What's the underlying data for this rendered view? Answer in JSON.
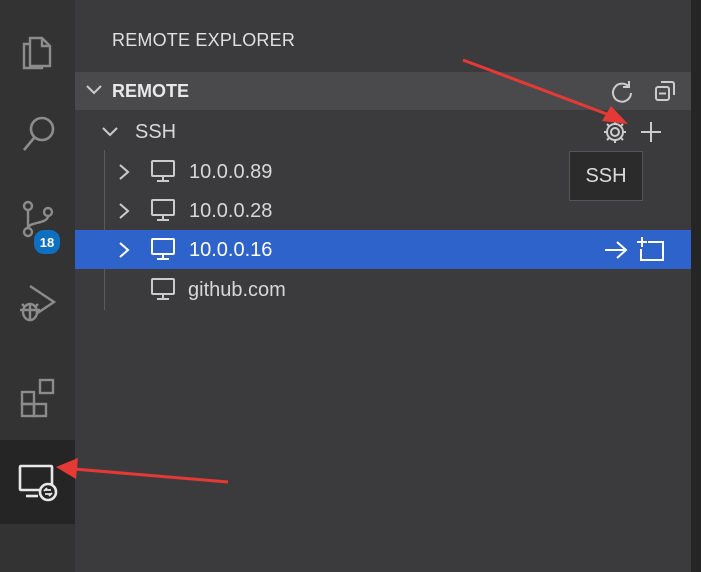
{
  "activity_bar": {
    "items": [
      {
        "icon": "files-icon"
      },
      {
        "icon": "search-icon"
      },
      {
        "icon": "source-control-icon",
        "badge": "18"
      },
      {
        "icon": "run-debug-icon"
      },
      {
        "icon": "extensions-icon"
      },
      {
        "icon": "remote-explorer-icon",
        "active": true
      }
    ]
  },
  "sidebar": {
    "title": "REMOTE EXPLORER",
    "section": {
      "title": "REMOTE",
      "actions": [
        "refresh-icon",
        "collapse-all-icon"
      ]
    },
    "group": {
      "label": "SSH",
      "actions": [
        "gear-icon",
        "add-icon"
      ],
      "tooltip": "SSH"
    },
    "hosts": [
      {
        "label": "10.0.0.89",
        "expandable": true
      },
      {
        "label": "10.0.0.28",
        "expandable": true
      },
      {
        "label": "10.0.0.16",
        "expandable": true,
        "selected": true,
        "actions": [
          "connect-arrow-icon",
          "open-new-window-icon"
        ]
      },
      {
        "label": "github.com",
        "expandable": false
      }
    ]
  },
  "colors": {
    "selection": "#2f63cc",
    "badge": "#0e70c0",
    "annotation_arrow": "#e53935"
  }
}
